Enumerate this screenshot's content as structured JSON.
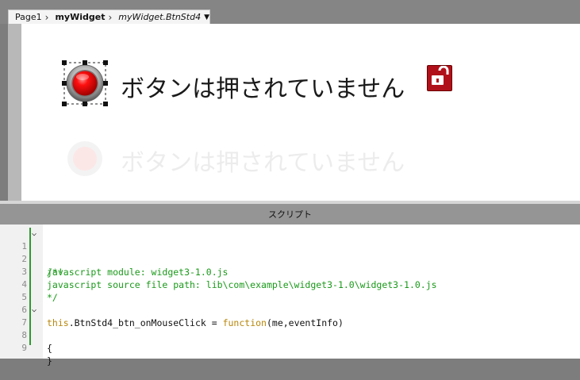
{
  "breadcrumb": {
    "page": "Page1",
    "widget": "myWidget",
    "component": "myWidget.BtnStd4"
  },
  "canvas": {
    "button_label": "ボタンは押されていません",
    "ghost_label": "ボタンは押されていません"
  },
  "script_panel": {
    "title": "スクリプト"
  },
  "editor": {
    "lines": [
      {
        "no": "1",
        "text": "/*!"
      },
      {
        "no": "2",
        "text": "javascript module: widget3-1.0.js"
      },
      {
        "no": "3",
        "text": "javascript source file path: lib\\com\\example\\widget3-1.0\\widget3-1.0.js"
      },
      {
        "no": "4",
        "text": "*/"
      },
      {
        "no": "5",
        "text": ""
      },
      {
        "no": "6",
        "text_this": "this",
        "text_mid": ".BtnStd4_btn_onMouseClick = ",
        "text_fn": "function",
        "text_end": "(me,eventInfo)"
      },
      {
        "no": "7",
        "text": "{"
      },
      {
        "no": "8",
        "text": ""
      },
      {
        "no": "9",
        "text": "}"
      }
    ]
  },
  "colors": {
    "comment": "#1a9a1a",
    "keyword": "#b8860b",
    "fold_marker": "#2e9a2e",
    "lock": "#b0101a",
    "button_red": "#e00000"
  },
  "icons": {
    "lock": "unlocked-padlock-icon",
    "button": "red-round-button-icon",
    "fold": "chevron-down-icon"
  }
}
